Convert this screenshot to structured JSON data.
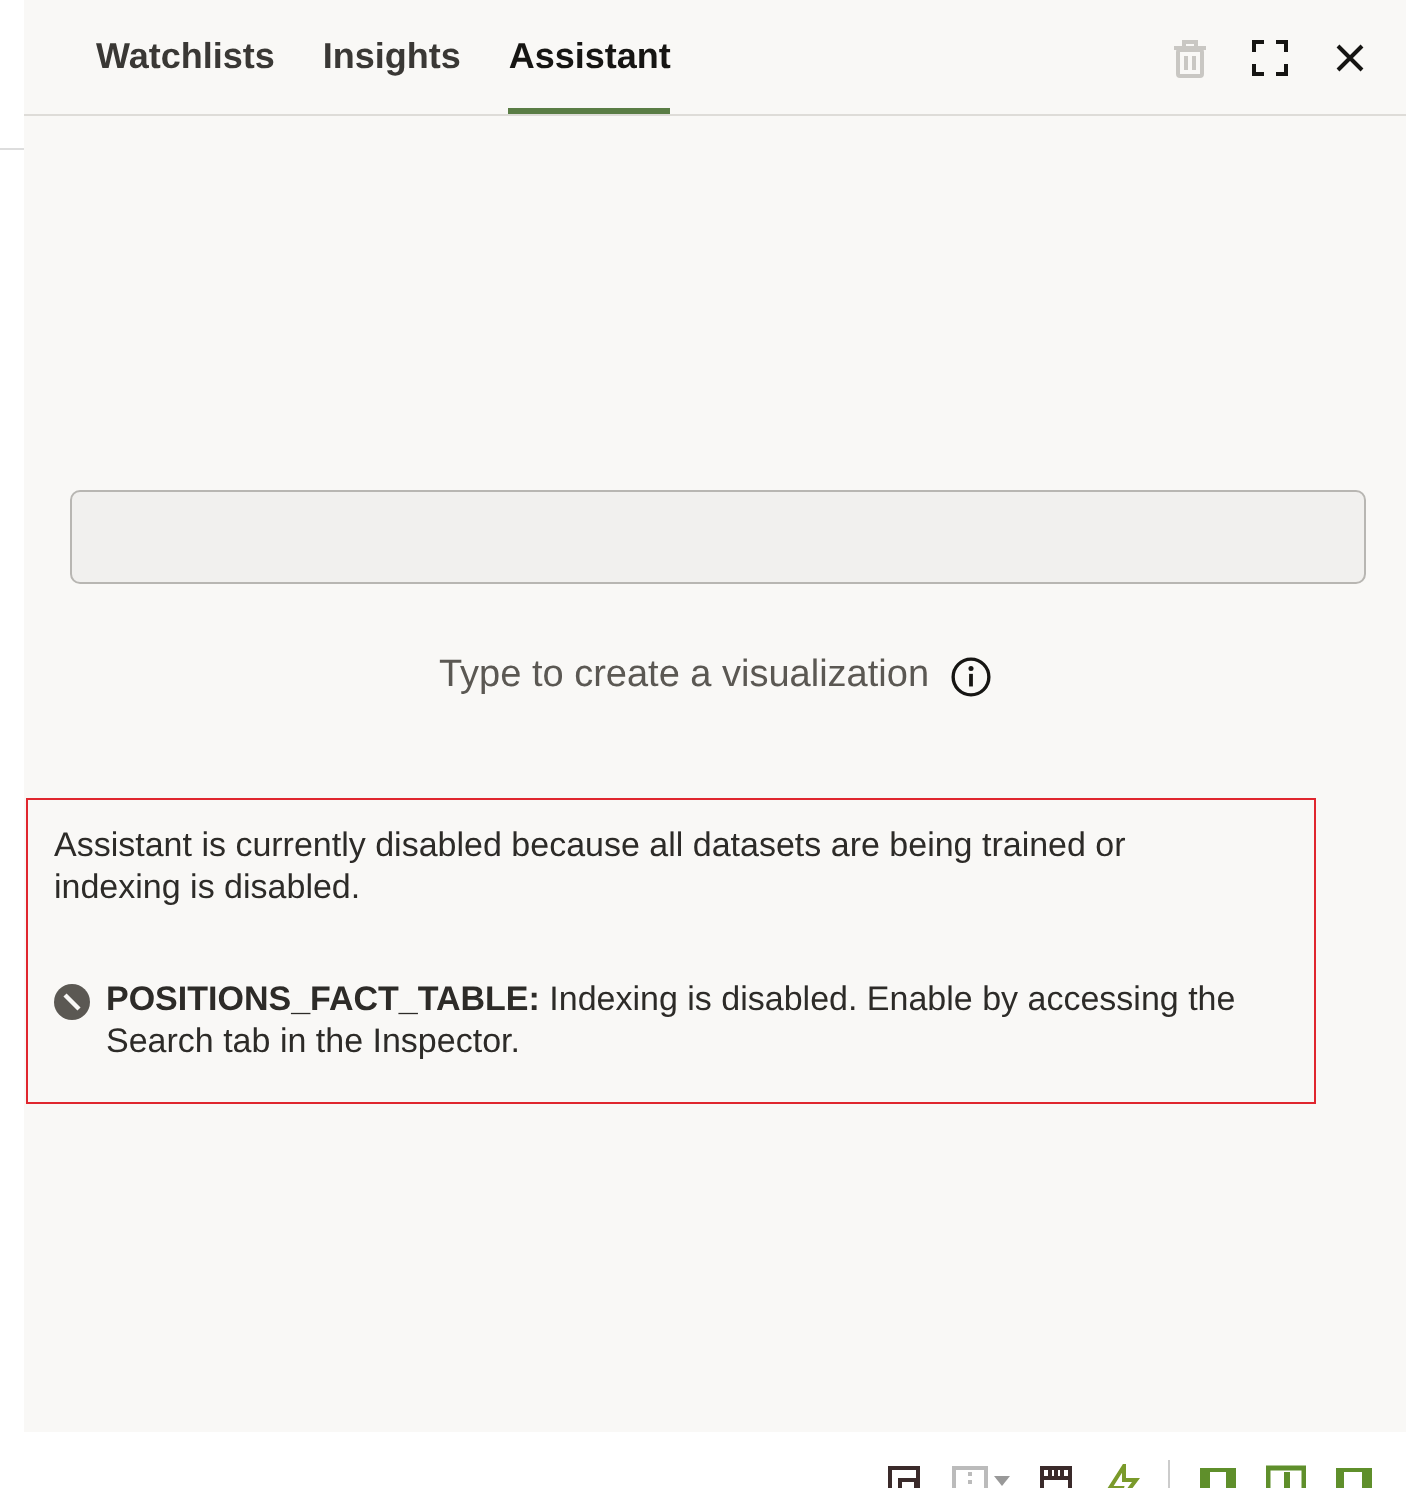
{
  "tabs": [
    {
      "label": "Watchlists",
      "selected": false
    },
    {
      "label": "Insights",
      "selected": false
    },
    {
      "label": "Assistant",
      "selected": true
    }
  ],
  "header_actions": [
    {
      "kind": "delete",
      "disabled": true
    },
    {
      "kind": "maximize",
      "disabled": false
    },
    {
      "kind": "close",
      "disabled": false
    }
  ],
  "hint": "Type to create a visualization",
  "messages": [
    {
      "kind": "plain",
      "text": "Assistant is currently disabled because all datasets are being trained or indexing is disabled."
    },
    {
      "kind": "blocked",
      "text": "**POSITIONS_FACT_TABLE:** Indexing is disabled. Enable by accessing the Search tab in the Inspector."
    }
  ]
}
